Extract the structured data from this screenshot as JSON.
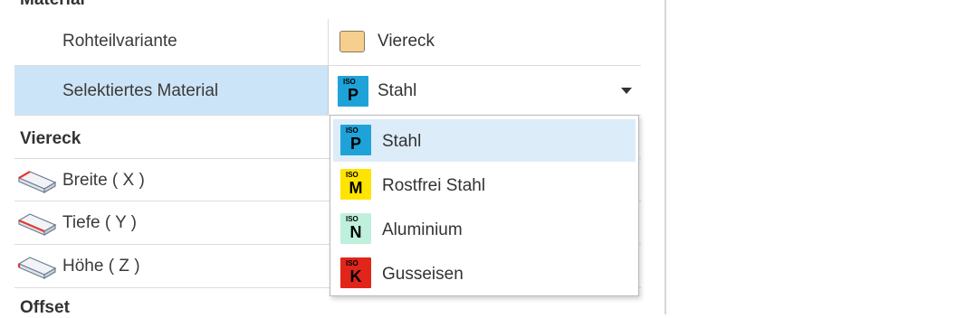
{
  "sections": {
    "material": "Material",
    "viereck": "Viereck",
    "offset": "Offset"
  },
  "rows": {
    "blank_variant": {
      "label": "Rohteilvariante",
      "value": "Viereck"
    },
    "selected_material": {
      "label": "Selektiertes Material",
      "value": "Stahl",
      "iso_code": "P",
      "iso_tag": "ISO"
    },
    "width": {
      "label": "Breite ( X )"
    },
    "depth": {
      "label": "Tiefe  ( Y )"
    },
    "height": {
      "label": "Höhe  ( Z )"
    }
  },
  "dropdown": {
    "options": [
      {
        "label": "Stahl",
        "iso_code": "P",
        "iso_tag": "ISO",
        "color": "#1fa2d8",
        "highlighted": true
      },
      {
        "label": "Rostfrei Stahl",
        "iso_code": "M",
        "iso_tag": "ISO",
        "color": "#ffe400",
        "highlighted": false
      },
      {
        "label": "Aluminium",
        "iso_code": "N",
        "iso_tag": "ISO",
        "color": "#bff0dc",
        "highlighted": false
      },
      {
        "label": "Gusseisen",
        "iso_code": "K",
        "iso_tag": "ISO",
        "color": "#e1251b",
        "highlighted": false
      }
    ]
  },
  "icons": {
    "swatch": "color-swatch-icon",
    "dimension": "dimension-block-icon",
    "dropdown": "chevron-down-icon"
  },
  "colors": {
    "selected_row": "#cce4f7",
    "highlight_option": "#dcecf9",
    "blank_swatch": "#f6cf8e"
  }
}
